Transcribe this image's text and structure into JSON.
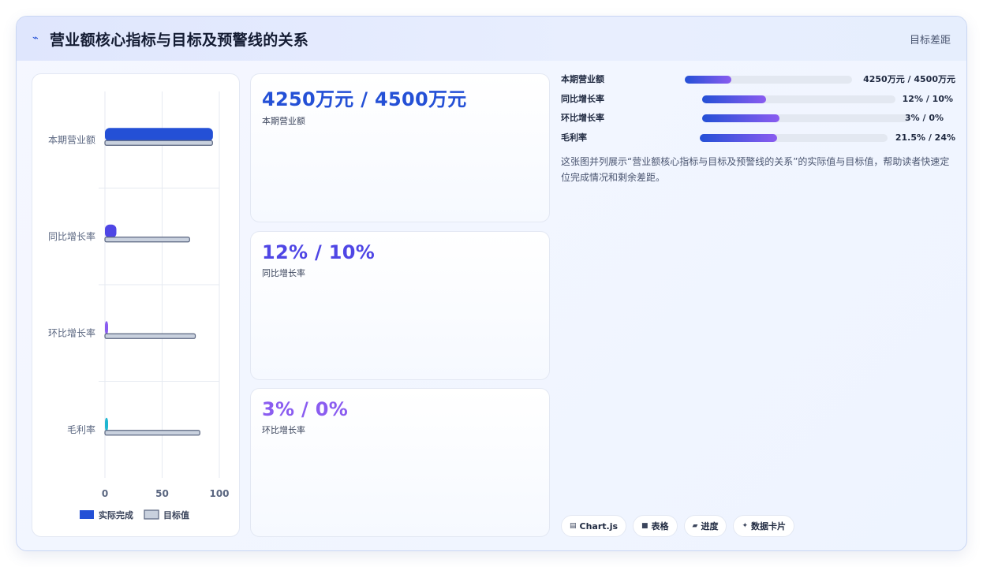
{
  "header": {
    "title": "营业额核心指标与目标及预警线的关系",
    "subtitle": "目标差距",
    "icon": "pulse-icon"
  },
  "chart_data": {
    "type": "bar",
    "orientation": "horizontal",
    "categories": [
      "本期营业额",
      "同比增长率",
      "环比增长率",
      "毛利率"
    ],
    "series": [
      {
        "name": "实际完成",
        "values": [
          94.4,
          10,
          2,
          2.5
        ],
        "colors": [
          "#2450d6",
          "#4f46e5",
          "#8a5cf0",
          "#1fb6d1"
        ]
      },
      {
        "name": "目标值",
        "values": [
          94,
          74,
          79,
          83
        ],
        "color": "#c9d1de"
      }
    ],
    "xlim": [
      0,
      100
    ],
    "xticks": [
      "0",
      "50",
      "100"
    ],
    "grid": true,
    "legend": "bottom"
  },
  "kpis": [
    {
      "value": "4250万元 / 4500万元",
      "label": "本期营业额",
      "color": "#2450d6"
    },
    {
      "value": "12% / 10%",
      "label": "同比增长率",
      "color": "#4f46e5"
    },
    {
      "value": "3% / 0%",
      "label": "环比增长率",
      "color": "#8a5cf0"
    }
  ],
  "progress": [
    {
      "label": "本期营业额",
      "text": "4250万元 / 4500万元",
      "fraction": 0.28
    },
    {
      "label": "同比增长率",
      "text": "12% / 10%",
      "fraction": 0.33
    },
    {
      "label": "环比增长率",
      "text": "3% / 0%",
      "fraction": 0.37
    },
    {
      "label": "毛利率",
      "text": "21.5% / 24%",
      "fraction": 0.41
    }
  ],
  "description": "这张图并列展示“营业额核心指标与目标及预警线的关系”的实际值与目标值，帮助读者快速定位完成情况和剩余差距。",
  "tags": [
    {
      "label": "Chart.js",
      "icon": "chart-icon"
    },
    {
      "label": "表格",
      "icon": "table-icon"
    },
    {
      "label": "进度",
      "icon": "progress-icon"
    },
    {
      "label": "数据卡片",
      "icon": "card-icon"
    }
  ]
}
